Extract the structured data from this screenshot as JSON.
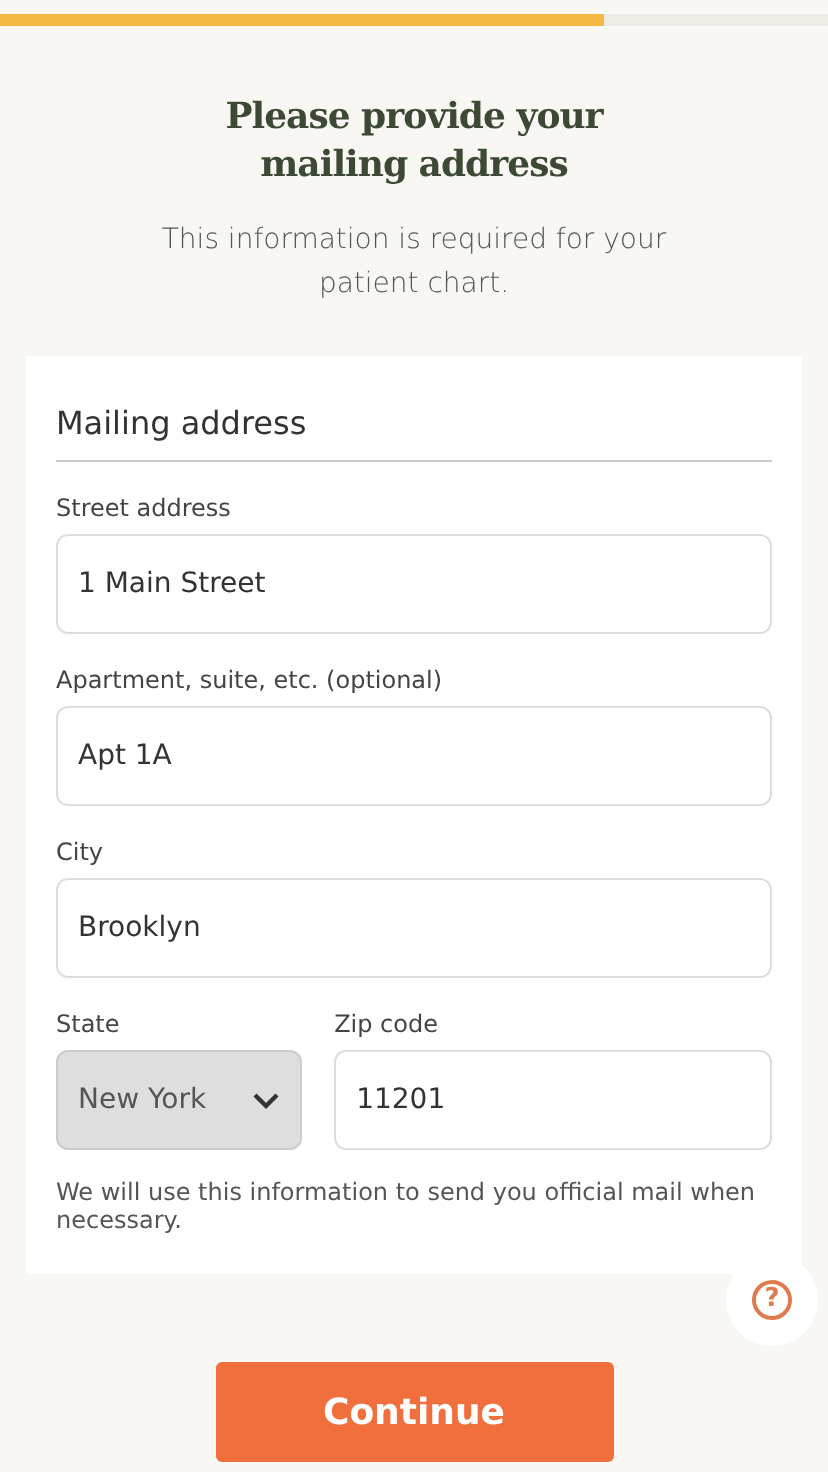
{
  "progress": {
    "level": 0.73
  },
  "heading": "Please provide your mailing address",
  "subtitle": "This information is required for your patient chart.",
  "form": {
    "title": "Mailing address",
    "fields": [
      {
        "kind": "text",
        "label": "Street address",
        "value": "1 Main Street",
        "disabled": false
      },
      {
        "kind": "text",
        "label": "Apartment, suite, etc. (optional)",
        "value": "Apt 1A",
        "disabled": false
      },
      {
        "kind": "text",
        "label": "City",
        "value": "Brooklyn",
        "disabled": false
      },
      {
        "kind": "select",
        "label": "State",
        "value": "New York",
        "disabled": true
      },
      {
        "kind": "text",
        "label": "Zip code",
        "value": "11201",
        "disabled": false
      }
    ],
    "note": "We will use this information to send you official mail when necessary."
  },
  "help_button": "?",
  "continue_button": "Continue"
}
